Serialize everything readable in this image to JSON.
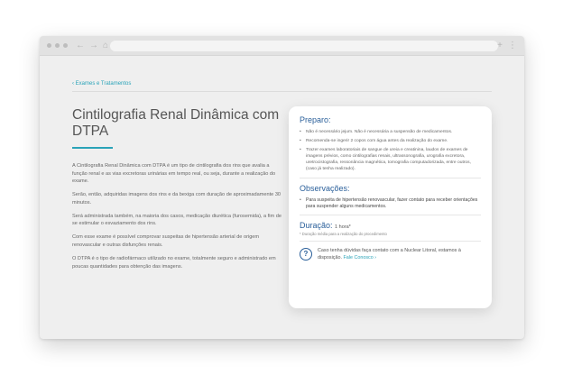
{
  "breadcrumb": {
    "icon": "chevron-left-icon",
    "label": "Exames e Tratamentos"
  },
  "title": "Cintilografia Renal Dinâmica com DTPA",
  "paragraphs": [
    "A Cintilografia Renal Dinâmica com DTPA é um tipo de cintilografia dos rins que avalia a função renal e as vias excretoras urinárias em tempo real, ou seja, durante a realização do exame.",
    "Serão, então, adquiridas imagens dos rins e da bexiga com duração de aproximadamente 30 minutos.",
    "Será administrada também, na maioria dos casos, medicação diurética (furosemida), a fim de se estimular o esvaziamento dos rins.",
    "Com esse exame é possível comprovar suspeitas de hipertensão arterial de origem renovascular e outras disfunções renais.",
    "O DTPA é o tipo de radiofármaco utilizado no exame, totalmente seguro e administrado em poucas quantidades para obtenção das imagens."
  ],
  "card": {
    "preparo_title": "Preparo:",
    "preparo_items": [
      "Não é necessário jejum. Não é necessária a suspensão de medicamentos.",
      "Recomenda-se ingerir 2 copos com água antes da realização do exame.",
      "Trazer exames laboratoriais de sangue de ureia e creatinina, laudos de exames de imagens prévios, como cintilografias renais, ultrassonografia, urografia excretora, uretrocistografia, ressonância magnética, tomografia computadorizada, entre outros, (caso já tenha realizado)."
    ],
    "obs_title": "Observações:",
    "obs_items": [
      "Para suspeita de hipertensão renovascular, fazer contato para receber orientações para suspender alguns medicamentos."
    ],
    "duracao_label": "Duração:",
    "duracao_value": "1 hora*",
    "duracao_note": "* Duração média para a realização do procedimento",
    "contact_text": "Caso tenha dúvidas faça contato com a Nuclear Litoral, estamos à disposição.",
    "contact_link": "Fale Conosco ›",
    "contact_icon": "help-circle-icon"
  },
  "colors": {
    "accent": "#2aa3b8",
    "heading": "#2a5f9a"
  }
}
